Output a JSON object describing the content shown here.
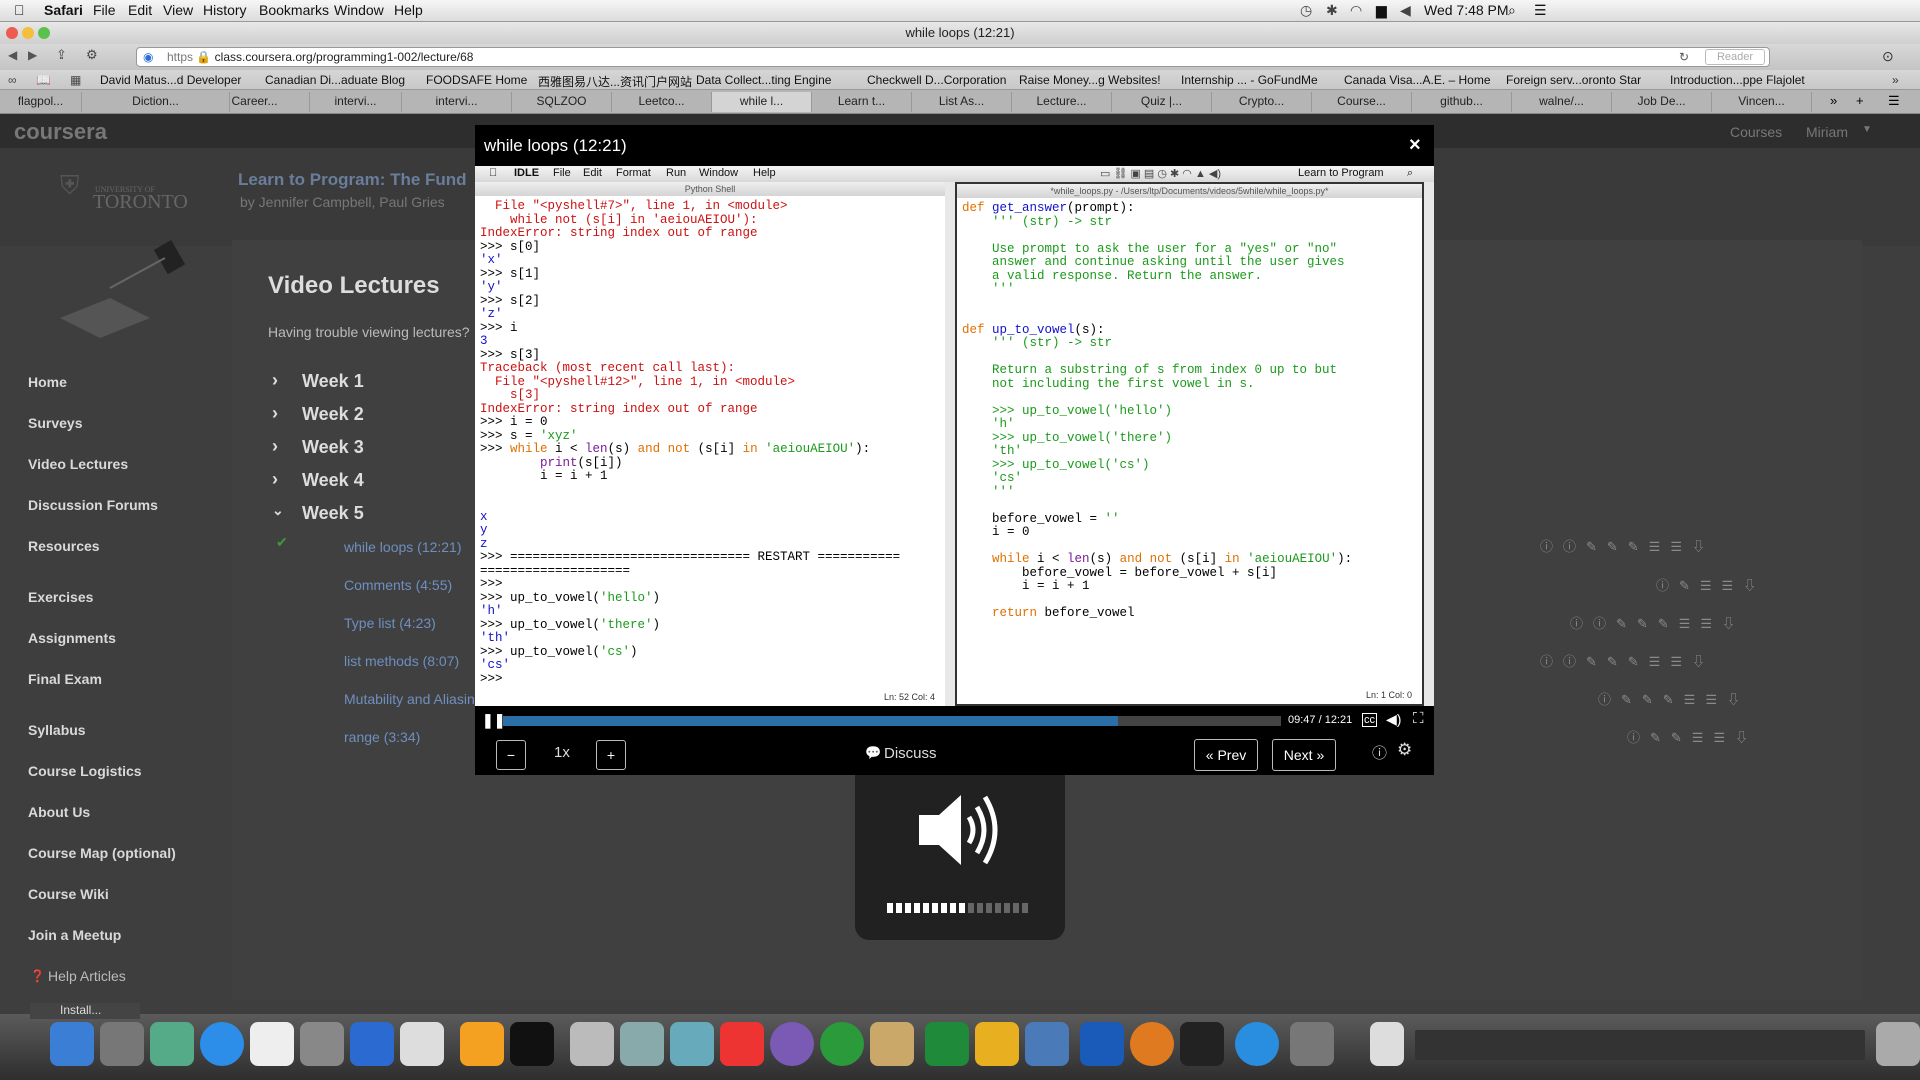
{
  "menubar": {
    "app": "Safari",
    "items": [
      "File",
      "Edit",
      "View",
      "History",
      "Bookmarks",
      "Window",
      "Help"
    ],
    "clock": "Wed 7:48 PM"
  },
  "window": {
    "title": "while loops (12:21)"
  },
  "toolbar": {
    "url_scheme": "https",
    "url": "class.coursera.org/programming1-002/lecture/68",
    "reader": "Reader"
  },
  "bookmarks": [
    "David Matus...d Developer",
    "Canadian Di...aduate Blog",
    "FOODSAFE Home",
    "西雅图易八达...资讯门户网站",
    "Data Collect...ting Engine",
    "Checkwell D...Corporation",
    "Raise Money...g Websites!",
    "Internship ... - GoFundMe",
    "Canada Visa...A.E. – Home",
    "Foreign serv...oronto Star",
    "Introduction...ppe Flajolet"
  ],
  "tabs": [
    "flagpol...",
    "Diction...",
    "Career...",
    "intervi...",
    "intervi...",
    "SQLZOO",
    "Leetco...",
    "while l...",
    "Learn t...",
    "List As...",
    "Lecture...",
    "Quiz |...",
    "Crypto...",
    "Course...",
    "github...",
    "walne/...",
    "Job De...",
    "Vincen..."
  ],
  "coursera": {
    "logo": "coursera",
    "nav_courses": "Courses",
    "nav_user": "Miriam",
    "university_small": "UNIVERSITY OF",
    "university": "TORONTO",
    "course_title": "Learn to Program: The Fund",
    "course_by": "by Jennifer Campbell, Paul Gries",
    "section_title": "Video Lectures",
    "trouble": "Having trouble viewing lectures?"
  },
  "sidebar": [
    {
      "label": "Home"
    },
    {
      "label": "Surveys"
    },
    {
      "label": "Video Lectures"
    },
    {
      "label": "Discussion Forums"
    },
    {
      "label": "Resources"
    },
    {
      "label": "Exercises"
    },
    {
      "label": "Assignments"
    },
    {
      "label": "Final Exam"
    },
    {
      "label": "Syllabus"
    },
    {
      "label": "Course Logistics"
    },
    {
      "label": "About Us"
    },
    {
      "label": "Course Map (optional)"
    },
    {
      "label": "Course Wiki"
    },
    {
      "label": "Join a Meetup"
    },
    {
      "label": "Help Articles"
    }
  ],
  "weeks": [
    "Week 1",
    "Week 2",
    "Week 3",
    "Week 4",
    "Week 5"
  ],
  "lectures": [
    "while loops (12:21)",
    "Comments (4:55)",
    "Type list (4:23)",
    "list methods (8:07)",
    "Mutability and Aliasin",
    "range (3:34)"
  ],
  "video": {
    "title": "while loops (12:21)",
    "close": "×",
    "idle_menus": [
      "IDLE",
      "File",
      "Edit",
      "Format",
      "Run",
      "Window",
      "Help"
    ],
    "idle_right": "Learn to Program",
    "shell_title": "Python Shell",
    "editor_title": "*while_loops.py - /Users/ltp/Documents/videos/5while/while_loops.py*",
    "shell_status": "Ln: 52 Col: 4",
    "editor_status": "Ln: 1 Col: 0"
  },
  "player": {
    "time": "09:47 / 12:21",
    "progress": 0.79,
    "speed": "1x",
    "minus": "−",
    "plus": "+",
    "discuss": "Discuss",
    "prev": "« Prev",
    "next": "Next »"
  },
  "volume": {
    "level": 0.55
  },
  "dock": {
    "install": "Install..."
  }
}
